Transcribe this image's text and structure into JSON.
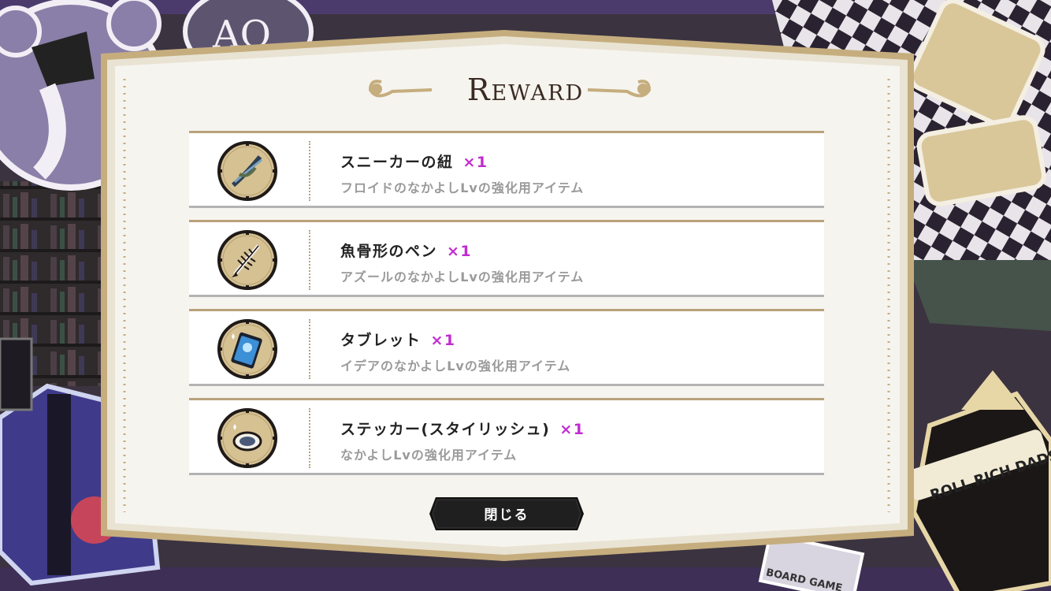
{
  "dialog": {
    "title": "Reward",
    "close_label": "閉じる"
  },
  "rewards": [
    {
      "name": "スニーカーの紐",
      "qty": "×1",
      "desc": "フロイドのなかよしLvの強化用アイテム",
      "icon": "shoelace-icon"
    },
    {
      "name": "魚骨形のペン",
      "qty": "×1",
      "desc": "アズールのなかよしLvの強化用アイテム",
      "icon": "fishbone-pen-icon"
    },
    {
      "name": "タブレット",
      "qty": "×1",
      "desc": "イデアのなかよしLvの強化用アイテム",
      "icon": "tablet-icon"
    },
    {
      "name": "ステッカー(スタイリッシュ)",
      "qty": "×1",
      "desc": "なかよしLvの強化用アイテム",
      "icon": "sticker-icon"
    }
  ],
  "background": {
    "banner_text": "ROLL RICH DADS",
    "board_game_text": "BOARD GAME"
  },
  "colors": {
    "quantity": "#c22ad0",
    "frame_gold": "#b9a27a",
    "panel_bg": "#f6f4ef"
  }
}
